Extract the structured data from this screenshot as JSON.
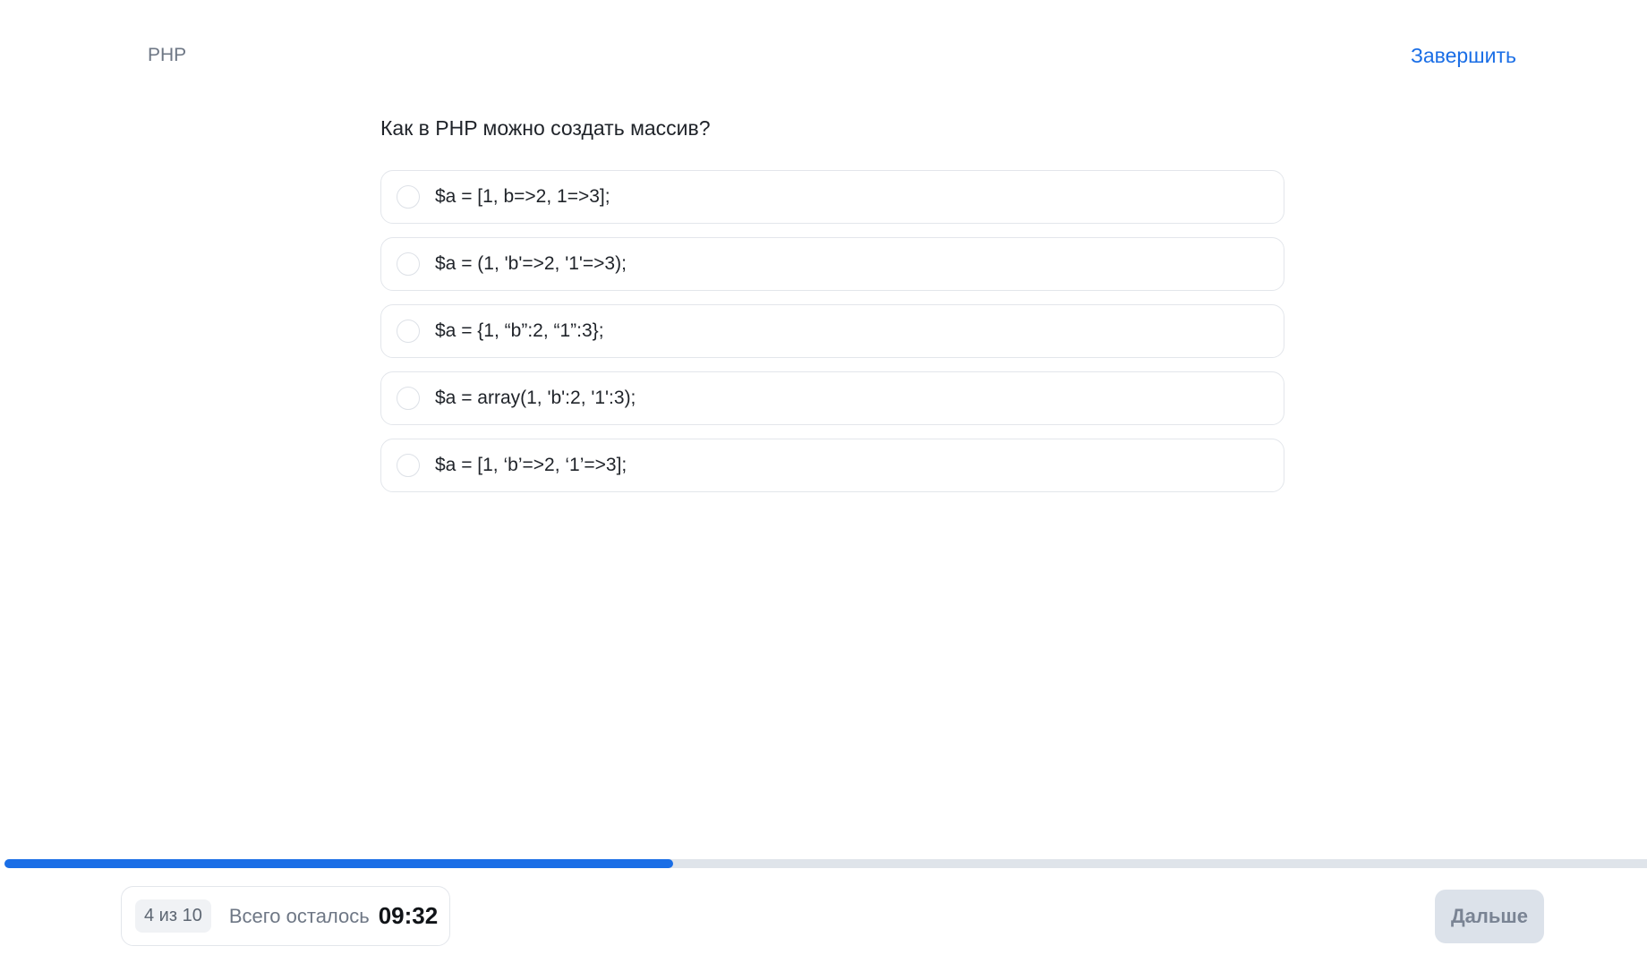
{
  "header": {
    "topic": "PHP",
    "finish_label": "Завершить"
  },
  "question": {
    "text": "Как в PHP можно создать массив?",
    "options": [
      {
        "label": "$a = [1, b=>2, 1=>3];"
      },
      {
        "label": "$a = (1, 'b'=>2, '1'=>3);"
      },
      {
        "label": "$a = {1, “b”:2, “1”:3};"
      },
      {
        "label": "$a = array(1, 'b':2, '1':3);"
      },
      {
        "label": "$a = [1, ‘b’=>2, ‘1’=>3];"
      }
    ],
    "selected_index": null
  },
  "progress": {
    "current": 4,
    "total": 10,
    "fraction": 0.4,
    "bar_color": "#1a6ee6",
    "track_color": "#dfe4ea"
  },
  "footer": {
    "counter_label": "4 из 10",
    "remaining_label": "Всего осталось",
    "timer": "09:32",
    "next_label": "Дальше",
    "next_disabled": true
  }
}
